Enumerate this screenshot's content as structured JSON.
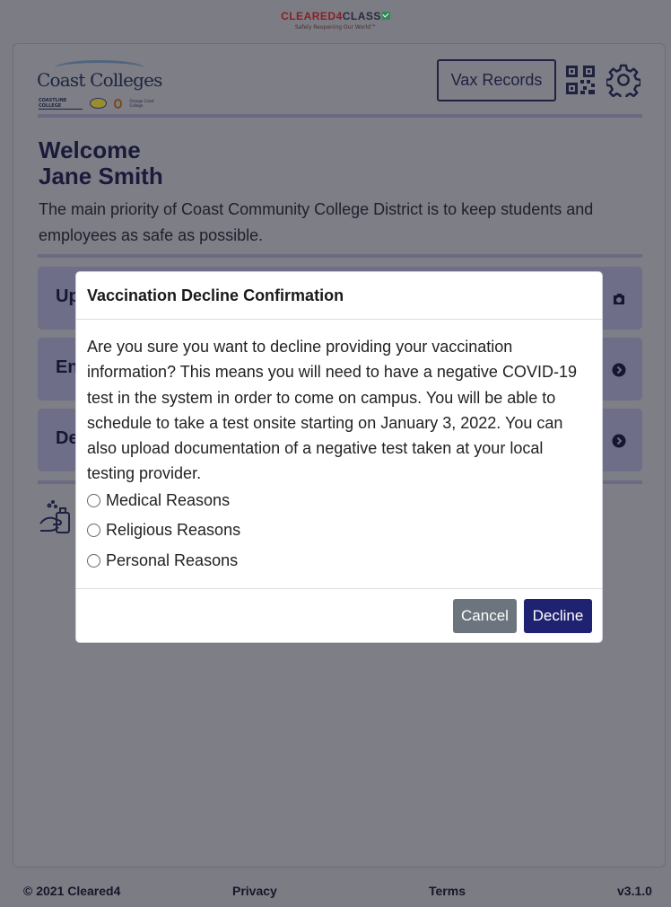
{
  "brand": {
    "name_part1": "CLEARED4",
    "name_part2": "CLASS",
    "tagline": "Safely Reopening Our World™"
  },
  "header": {
    "logo": {
      "title": "Coast Colleges",
      "sub_coastline": "COASTLINE COLLEGE",
      "sub_occ": "Orange Coast College"
    },
    "vax_records_label": "Vax Records",
    "qr_icon": "qr-code-icon",
    "settings_icon": "gear-icon"
  },
  "welcome": {
    "line1": "Welcome",
    "line2": "Jane Smith",
    "intro": "The main priority of Coast Community College District is to keep students and employees as safe as possible."
  },
  "actions": [
    {
      "label_visible": "Up",
      "icon": "camera-icon"
    },
    {
      "label_visible": "En",
      "icon": "chevron-right-circle-icon"
    },
    {
      "label_visible": "De",
      "icon": "chevron-right-circle-icon"
    }
  ],
  "modal": {
    "title": "Vaccination Decline Confirmation",
    "body": "Are you sure you want to decline providing your vaccination information? This means you will need to have a negative COVID-19 test in the system in order to come on campus. You will be able to schedule to take a test onsite starting on January 3, 2022. You can also upload documentation of a negative test taken at your local testing provider.",
    "options": [
      {
        "label": "Medical Reasons",
        "selected": false
      },
      {
        "label": "Religious Reasons",
        "selected": false
      },
      {
        "label": "Personal Reasons",
        "selected": false
      }
    ],
    "cancel_label": "Cancel",
    "decline_label": "Decline"
  },
  "footer": {
    "copyright": "© 2021 Cleared4",
    "privacy": "Privacy",
    "terms": "Terms",
    "version": "v3.1.0"
  },
  "colors": {
    "overlay_bg": "#7c7c84",
    "primary": "#1f2270",
    "cancel": "#6c757d"
  }
}
